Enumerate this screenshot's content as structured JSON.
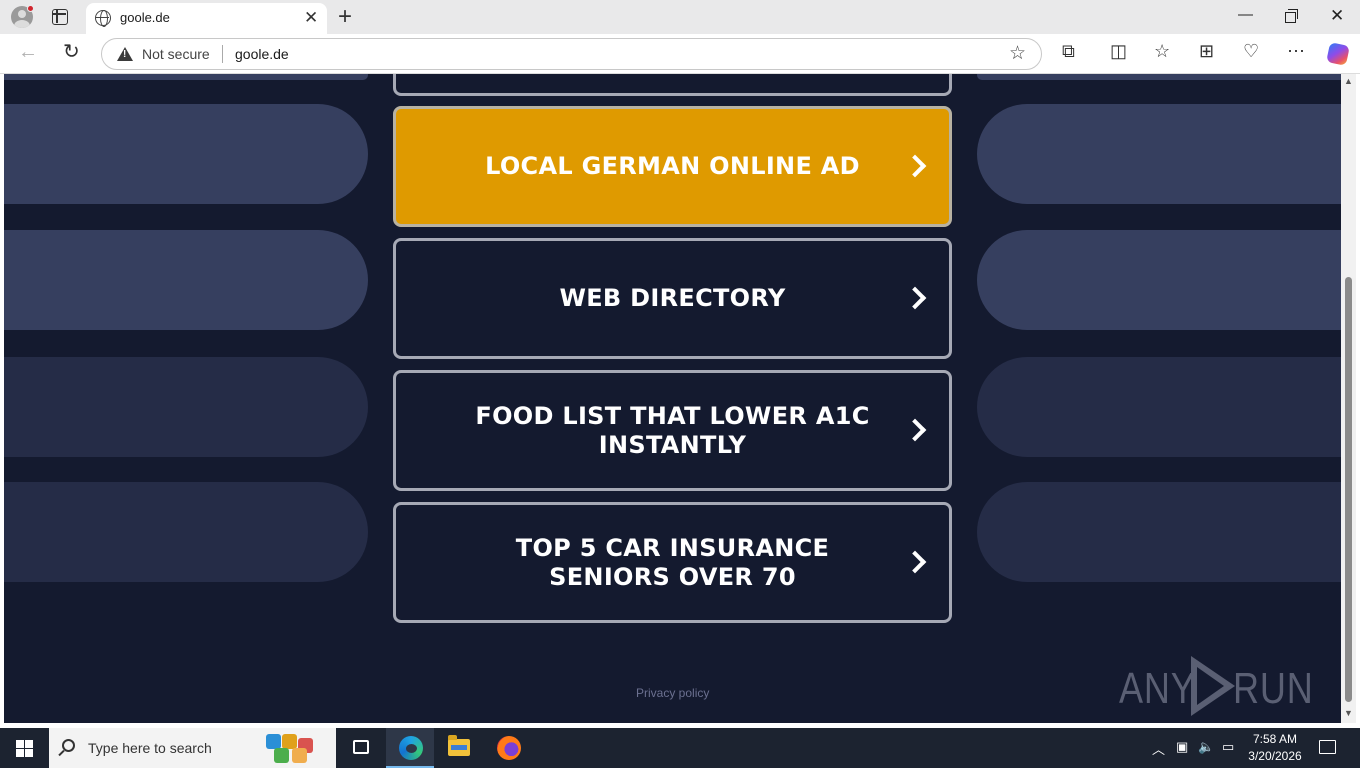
{
  "browser": {
    "tab_title": "goole.de",
    "security_label": "Not secure",
    "url": "goole.de"
  },
  "page": {
    "ads": [
      {
        "label": "LOCAL GERMAN ONLINE AD",
        "highlighted": true
      },
      {
        "label": "WEB DIRECTORY",
        "highlighted": false
      },
      {
        "label": "FOOD LIST THAT LOWER A1C INSTANTLY",
        "highlighted": false
      },
      {
        "label": "TOP 5 CAR INSURANCE SENIORS OVER 70",
        "highlighted": false
      }
    ],
    "privacy_link": "Privacy policy",
    "watermark_any": "ANY",
    "watermark_run": "RUN"
  },
  "taskbar": {
    "search_placeholder": "Type here to search",
    "time": "7:58 AM",
    "date": "3/20/2026"
  },
  "colors": {
    "page_background": "#141a2f",
    "highlight": "#df9a00",
    "deco_pill": "#363f5f"
  },
  "icons": [
    "profile-icon",
    "tab-actions-icon",
    "globe-icon",
    "close-icon",
    "plus-icon",
    "back-icon",
    "reload-icon",
    "warning-icon",
    "star-icon",
    "extensions-icon",
    "split-screen-icon",
    "favorites-icon",
    "collections-icon",
    "browser-essentials-icon",
    "more-icon",
    "copilot-icon",
    "chevron-right-icon",
    "windows-start-icon",
    "search-icon",
    "task-view-icon",
    "edge-icon",
    "file-explorer-icon",
    "firefox-icon",
    "notifications-icon"
  ]
}
